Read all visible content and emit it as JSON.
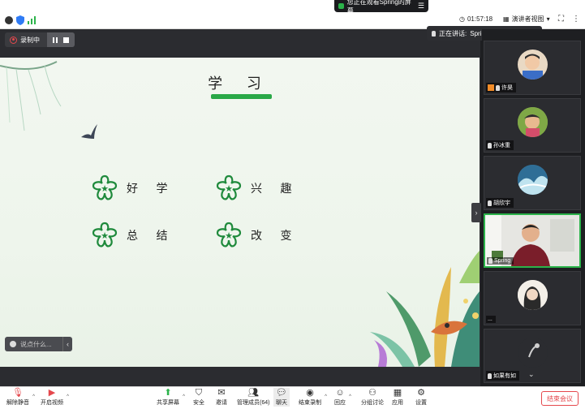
{
  "top_bar": {
    "sharing_notice": "您正在观看Spring的屏幕",
    "elapsed_time": "01:57:18",
    "view_mode": "演讲者视图"
  },
  "recording": {
    "label": "录制中"
  },
  "speaking": {
    "label": "正在讲话:",
    "name": "Spring;"
  },
  "slide": {
    "title": "学 习",
    "items": [
      "好 学",
      "兴 趣",
      "总 结",
      "改 变"
    ]
  },
  "chat": {
    "placeholder": "说点什么..."
  },
  "participants": [
    {
      "name": "许昊"
    },
    {
      "name": "孙冰重"
    },
    {
      "name": "胡欣宇"
    },
    {
      "name": "Spring"
    },
    {
      "name": "..."
    },
    {
      "name": "如果有如"
    }
  ],
  "toolbar": {
    "unmute": "解除静音",
    "start_video": "开启视频",
    "share_screen": "共享屏幕",
    "security": "安全",
    "invite": "邀请",
    "manage_members": "管理成员(64)",
    "chat": "聊天",
    "end_recording": "结束录制",
    "reactions": "回应",
    "breakout": "分组讨论",
    "apps": "应用",
    "settings": "设置",
    "end_meeting": "结束会议"
  },
  "colors": {
    "accent_green": "#29a847",
    "end_red": "#e5484d",
    "active_border": "#2bb34a"
  }
}
